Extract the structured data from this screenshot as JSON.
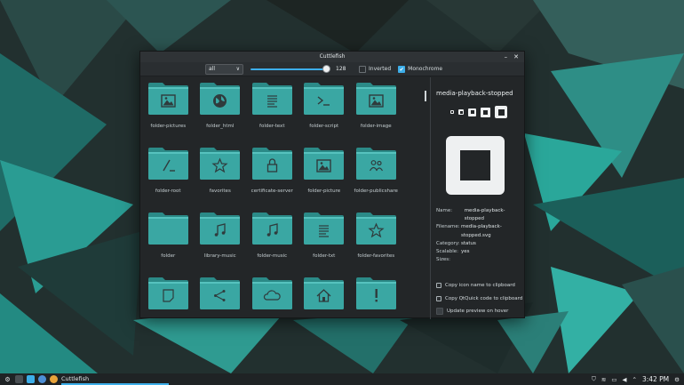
{
  "window": {
    "title": "Cuttlefish",
    "minimize_glyph": "–",
    "close_glyph": "✕"
  },
  "toolbar": {
    "filter": {
      "selected": "all",
      "caret": "∨"
    },
    "size_slider": {
      "value": 128,
      "fraction": 1.0
    },
    "inverted": {
      "label": "Inverted",
      "checked": false
    },
    "monochrome": {
      "label": "Monochrome",
      "checked": true,
      "check_glyph": "✔"
    }
  },
  "icons": [
    {
      "label": "folder-pictures",
      "emblem": "picture-icon"
    },
    {
      "label": "folder_html",
      "emblem": "globe-icon"
    },
    {
      "label": "folder-text",
      "emblem": "text-icon"
    },
    {
      "label": "folder-script",
      "emblem": "terminal-icon"
    },
    {
      "label": "folder-image",
      "emblem": "picture-icon"
    },
    {
      "label": "folder-root",
      "emblem": "root-icon"
    },
    {
      "label": "favorites",
      "emblem": "star-icon"
    },
    {
      "label": "certificate-server",
      "emblem": "lock-icon"
    },
    {
      "label": "folder-picture",
      "emblem": "picture-icon"
    },
    {
      "label": "folder-publicshare",
      "emblem": "users-icon"
    },
    {
      "label": "folder",
      "emblem": ""
    },
    {
      "label": "library-music",
      "emblem": "music-icon"
    },
    {
      "label": "folder-music",
      "emblem": "music-icon"
    },
    {
      "label": "folder-txt",
      "emblem": "text-icon"
    },
    {
      "label": "folder-favorites",
      "emblem": "star-icon"
    },
    {
      "label": "",
      "emblem": "note-icon"
    },
    {
      "label": "",
      "emblem": "share-icon"
    },
    {
      "label": "",
      "emblem": "cloud-icon"
    },
    {
      "label": "",
      "emblem": "home-icon"
    },
    {
      "label": "",
      "emblem": "important-icon"
    }
  ],
  "detail": {
    "icon_name": "media-playback-stopped",
    "info": [
      {
        "key": "Name:",
        "value": "media-playback-stopped"
      },
      {
        "key": "Filename:",
        "value": "media-playback-stopped.svg"
      },
      {
        "key": "Category:",
        "value": "status"
      },
      {
        "key": "Scalable:",
        "value": "yes"
      },
      {
        "key": "Sizes:",
        "value": ""
      }
    ],
    "options": [
      {
        "label": "Copy icon name to clipboard",
        "checked": true
      },
      {
        "label": "Copy QtQuick code to clipboard",
        "checked": true
      },
      {
        "label": "Update preview on hover",
        "checked": false
      }
    ]
  },
  "taskbar": {
    "task_label": "Cuttlefish",
    "clock": "3:42 PM"
  },
  "colors": {
    "folder": "#3aa7a3",
    "folder_dark": "#2b8a87",
    "accent": "#3daee9"
  }
}
